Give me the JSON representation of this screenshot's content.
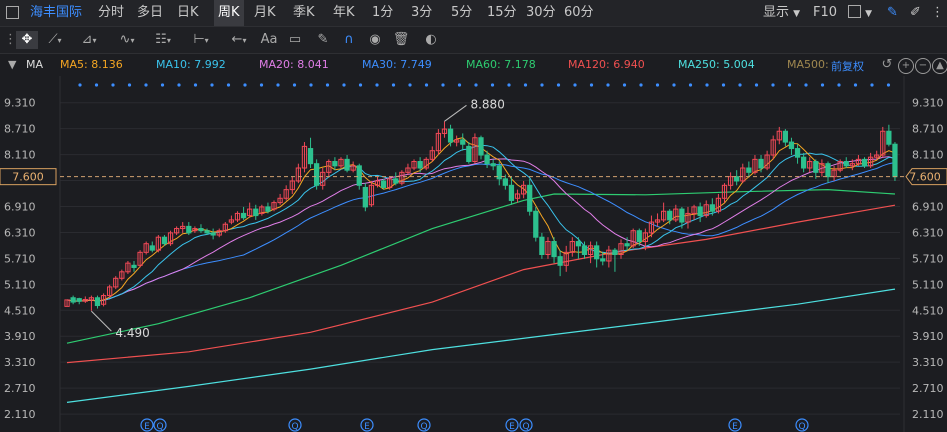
{
  "toolbar": {
    "stock_name": "海丰国际",
    "periods": [
      "分时",
      "多日",
      "日K",
      "周K",
      "月K",
      "季K",
      "年K",
      "1分",
      "3分",
      "5分",
      "15分",
      "30分",
      "60分"
    ],
    "selected_period": "周K",
    "display_label": "显示",
    "f10_label": "F10",
    "dropdown_icon": "chevron-down-icon"
  },
  "tools": {
    "text_tool_label": "Aa"
  },
  "indicators": {
    "label": "MA",
    "items": [
      {
        "label": "MA5: 8.136",
        "color": "#f5a623"
      },
      {
        "label": "MA10: 7.992",
        "color": "#3ac3ec"
      },
      {
        "label": "MA20: 8.041",
        "color": "#e07ee8"
      },
      {
        "label": "MA30: 7.749",
        "color": "#3d8eff"
      },
      {
        "label": "MA60: 7.178",
        "color": "#2ecc71"
      },
      {
        "label": "MA120: 6.940",
        "color": "#f05050"
      },
      {
        "label": "MA250: 5.004",
        "color": "#4ee0e0"
      },
      {
        "label": "MA500:",
        "color": "#a08850"
      }
    ],
    "adjust_label": "前复权"
  },
  "chart_data": {
    "type": "candlestick",
    "interval": "weekly",
    "y_ticks": [
      9.31,
      8.71,
      8.11,
      7.51,
      6.91,
      6.31,
      5.71,
      5.11,
      4.51,
      3.91,
      3.31,
      2.71,
      2.11
    ],
    "y_tick_labels": [
      "9.310",
      "8.710",
      "8.110",
      "7.510",
      "6.910",
      "6.310",
      "5.710",
      "5.110",
      "4.510",
      "3.910",
      "3.310",
      "2.710",
      "2.110"
    ],
    "ylim": [
      1.95,
      9.65
    ],
    "current_price": 7.6,
    "current_price_label": "7.600",
    "annotations": [
      {
        "text": "8.880",
        "value": 8.88,
        "type": "high"
      },
      {
        "text": "4.490",
        "value": 4.49,
        "type": "low"
      }
    ],
    "candles": [
      [
        4.6,
        4.75,
        4.75,
        4.6
      ],
      [
        4.8,
        4.7,
        4.85,
        4.65
      ],
      [
        4.78,
        4.72,
        4.8,
        4.65
      ],
      [
        4.72,
        4.76,
        4.83,
        4.68
      ],
      [
        4.75,
        4.8,
        4.85,
        4.5
      ],
      [
        4.8,
        4.62,
        4.85,
        4.55
      ],
      [
        4.65,
        4.85,
        4.9,
        4.6
      ],
      [
        4.85,
        5.05,
        5.1,
        4.8
      ],
      [
        5.05,
        5.25,
        5.3,
        5.0
      ],
      [
        5.25,
        5.4,
        5.45,
        5.2
      ],
      [
        5.4,
        5.6,
        5.65,
        5.35
      ],
      [
        5.55,
        5.5,
        5.65,
        5.4
      ],
      [
        5.55,
        5.85,
        5.9,
        5.5
      ],
      [
        5.85,
        6.05,
        6.1,
        5.8
      ],
      [
        6.0,
        5.9,
        6.1,
        5.85
      ],
      [
        5.9,
        6.2,
        6.25,
        5.85
      ],
      [
        6.2,
        6.05,
        6.25,
        6.0
      ],
      [
        6.05,
        6.3,
        6.35,
        6.0
      ],
      [
        6.3,
        6.4,
        6.45,
        6.25
      ],
      [
        6.4,
        6.45,
        6.55,
        6.3
      ],
      [
        6.45,
        6.3,
        6.55,
        6.25
      ],
      [
        6.35,
        6.4,
        6.45,
        6.3
      ],
      [
        6.4,
        6.35,
        6.5,
        6.3
      ],
      [
        6.35,
        6.3,
        6.4,
        6.25
      ],
      [
        6.3,
        6.25,
        6.4,
        6.15
      ],
      [
        6.25,
        6.35,
        6.4,
        6.2
      ],
      [
        6.35,
        6.5,
        6.55,
        6.3
      ],
      [
        6.55,
        6.6,
        6.7,
        6.5
      ],
      [
        6.6,
        6.75,
        6.8,
        6.55
      ],
      [
        6.75,
        6.65,
        6.9,
        6.6
      ],
      [
        6.7,
        6.85,
        7.0,
        6.65
      ],
      [
        6.85,
        6.7,
        6.95,
        6.6
      ],
      [
        6.75,
        6.9,
        6.95,
        6.7
      ],
      [
        6.9,
        6.8,
        7.0,
        6.75
      ],
      [
        6.85,
        7.0,
        7.05,
        6.8
      ],
      [
        7.0,
        7.1,
        7.2,
        6.95
      ],
      [
        7.1,
        7.3,
        7.4,
        7.05
      ],
      [
        7.3,
        7.5,
        7.6,
        7.2
      ],
      [
        7.5,
        7.8,
        7.9,
        7.45
      ],
      [
        7.8,
        8.3,
        8.4,
        7.7
      ],
      [
        8.25,
        7.9,
        8.5,
        7.8
      ],
      [
        7.9,
        7.4,
        8.0,
        7.3
      ],
      [
        7.4,
        7.7,
        7.8,
        7.3
      ],
      [
        7.7,
        7.95,
        8.0,
        7.6
      ],
      [
        7.95,
        7.85,
        8.05,
        7.75
      ],
      [
        7.85,
        8.0,
        8.05,
        7.8
      ],
      [
        8.0,
        7.75,
        8.1,
        7.7
      ],
      [
        7.75,
        7.85,
        7.95,
        7.7
      ],
      [
        7.85,
        7.4,
        7.9,
        7.3
      ],
      [
        7.35,
        6.9,
        7.45,
        6.8
      ],
      [
        6.95,
        7.4,
        7.5,
        6.9
      ],
      [
        7.4,
        7.5,
        7.6,
        7.35
      ],
      [
        7.5,
        7.35,
        7.55,
        7.3
      ],
      [
        7.35,
        7.55,
        7.6,
        7.3
      ],
      [
        7.55,
        7.45,
        7.7,
        7.4
      ],
      [
        7.45,
        7.7,
        7.75,
        7.4
      ],
      [
        7.7,
        7.8,
        7.9,
        7.65
      ],
      [
        7.8,
        7.95,
        8.0,
        7.75
      ],
      [
        7.95,
        7.8,
        8.05,
        7.7
      ],
      [
        7.8,
        8.0,
        8.05,
        7.75
      ],
      [
        8.0,
        8.2,
        8.3,
        7.95
      ],
      [
        8.2,
        8.6,
        8.7,
        8.1
      ],
      [
        8.6,
        8.7,
        8.88,
        8.5
      ],
      [
        8.7,
        8.4,
        8.8,
        8.3
      ],
      [
        8.4,
        8.45,
        8.55,
        8.3
      ],
      [
        8.45,
        8.35,
        8.6,
        8.2
      ],
      [
        8.3,
        7.95,
        8.4,
        7.9
      ],
      [
        7.95,
        8.5,
        8.6,
        7.9
      ],
      [
        8.5,
        8.1,
        8.55,
        8.0
      ],
      [
        8.1,
        7.9,
        8.2,
        7.8
      ],
      [
        7.9,
        7.85,
        8.0,
        7.75
      ],
      [
        7.85,
        7.55,
        7.95,
        7.4
      ],
      [
        7.55,
        7.4,
        7.65,
        7.3
      ],
      [
        7.4,
        7.05,
        7.6,
        6.95
      ],
      [
        7.1,
        7.2,
        7.3,
        7.0
      ],
      [
        7.2,
        7.4,
        7.5,
        7.1
      ],
      [
        7.4,
        6.8,
        7.55,
        6.7
      ],
      [
        6.8,
        6.2,
        6.9,
        6.1
      ],
      [
        6.2,
        5.8,
        6.3,
        5.7
      ],
      [
        5.8,
        6.1,
        6.2,
        5.7
      ],
      [
        6.1,
        5.75,
        6.2,
        5.6
      ],
      [
        5.75,
        5.55,
        5.9,
        5.3
      ],
      [
        5.55,
        5.85,
        6.0,
        5.4
      ],
      [
        5.85,
        6.1,
        6.2,
        5.75
      ],
      [
        6.1,
        6.0,
        6.2,
        5.7
      ],
      [
        6.0,
        5.8,
        6.1,
        5.7
      ],
      [
        5.8,
        6.0,
        6.1,
        5.6
      ],
      [
        6.0,
        5.7,
        6.1,
        5.5
      ],
      [
        5.7,
        5.65,
        5.85,
        5.55
      ],
      [
        5.65,
        5.9,
        6.0,
        5.5
      ],
      [
        5.9,
        5.8,
        5.95,
        5.4
      ],
      [
        5.8,
        6.05,
        6.15,
        5.7
      ],
      [
        6.05,
        6.0,
        6.2,
        5.9
      ],
      [
        6.0,
        6.35,
        6.4,
        5.95
      ],
      [
        6.35,
        6.1,
        6.4,
        6.0
      ],
      [
        6.1,
        6.3,
        6.4,
        5.9
      ],
      [
        6.3,
        6.55,
        6.7,
        6.2
      ],
      [
        6.55,
        6.6,
        6.75,
        6.45
      ],
      [
        6.6,
        6.8,
        7.0,
        6.55
      ],
      [
        6.8,
        6.6,
        6.85,
        6.5
      ],
      [
        6.6,
        6.85,
        6.95,
        6.55
      ],
      [
        6.85,
        6.55,
        6.9,
        6.4
      ],
      [
        6.55,
        6.75,
        6.9,
        6.4
      ],
      [
        6.75,
        6.9,
        6.95,
        6.6
      ],
      [
        6.9,
        6.7,
        7.0,
        6.55
      ],
      [
        6.7,
        6.95,
        7.05,
        6.65
      ],
      [
        6.95,
        6.8,
        7.1,
        6.7
      ],
      [
        6.8,
        7.1,
        7.2,
        6.75
      ],
      [
        7.1,
        7.4,
        7.45,
        7.0
      ],
      [
        7.4,
        7.6,
        7.7,
        7.3
      ],
      [
        7.6,
        7.5,
        7.75,
        7.4
      ],
      [
        7.5,
        7.8,
        7.9,
        7.45
      ],
      [
        7.8,
        7.7,
        7.95,
        7.6
      ],
      [
        7.7,
        8.0,
        8.1,
        7.65
      ],
      [
        8.0,
        7.8,
        8.1,
        7.7
      ],
      [
        7.8,
        8.1,
        8.2,
        7.75
      ],
      [
        8.1,
        8.45,
        8.55,
        8.0
      ],
      [
        8.45,
        8.65,
        8.75,
        8.35
      ],
      [
        8.65,
        8.4,
        8.7,
        8.3
      ],
      [
        8.4,
        8.25,
        8.5,
        8.1
      ],
      [
        8.25,
        8.05,
        8.35,
        7.9
      ],
      [
        8.05,
        7.8,
        8.15,
        7.7
      ],
      [
        7.8,
        7.95,
        8.05,
        7.7
      ],
      [
        7.95,
        7.7,
        8.0,
        7.55
      ],
      [
        7.7,
        7.9,
        8.0,
        7.6
      ],
      [
        7.9,
        7.6,
        7.95,
        7.45
      ],
      [
        7.6,
        7.75,
        7.85,
        7.5
      ],
      [
        7.75,
        7.95,
        8.0,
        7.7
      ],
      [
        7.95,
        7.85,
        8.05,
        7.8
      ],
      [
        7.85,
        7.9,
        8.0,
        7.75
      ],
      [
        7.9,
        8.0,
        8.1,
        7.85
      ],
      [
        8.0,
        7.85,
        8.05,
        7.8
      ],
      [
        7.85,
        8.05,
        8.15,
        7.8
      ],
      [
        8.05,
        8.1,
        8.2,
        8.0
      ],
      [
        8.1,
        8.65,
        8.75,
        8.05
      ],
      [
        8.65,
        8.35,
        8.8,
        8.3
      ],
      [
        8.35,
        7.6,
        8.4,
        7.5
      ]
    ],
    "ma_colors": {
      "MA5": "#f5a623",
      "MA10": "#3ac3ec",
      "MA20": "#e07ee8",
      "MA30": "#3d8eff",
      "MA60": "#2ecc71",
      "MA120": "#f05050",
      "MA250": "#4ee0e0"
    },
    "ma60_points": [
      [
        0,
        3.75
      ],
      [
        15,
        4.2
      ],
      [
        30,
        4.8
      ],
      [
        45,
        5.55
      ],
      [
        60,
        6.4
      ],
      [
        75,
        7.05
      ],
      [
        80,
        7.2
      ],
      [
        95,
        7.18
      ],
      [
        110,
        7.25
      ],
      [
        125,
        7.3
      ],
      [
        140,
        7.2
      ]
    ],
    "ma120_points": [
      [
        0,
        3.3
      ],
      [
        20,
        3.55
      ],
      [
        40,
        4.0
      ],
      [
        60,
        4.7
      ],
      [
        75,
        5.45
      ],
      [
        90,
        5.85
      ],
      [
        105,
        6.15
      ],
      [
        120,
        6.55
      ],
      [
        140,
        6.94
      ]
    ],
    "ma250_points": [
      [
        0,
        2.38
      ],
      [
        20,
        2.75
      ],
      [
        40,
        3.15
      ],
      [
        60,
        3.6
      ],
      [
        80,
        3.95
      ],
      [
        100,
        4.3
      ],
      [
        120,
        4.65
      ],
      [
        140,
        5.0
      ]
    ],
    "markers_top": "dots",
    "markers_bottom": [
      "E",
      "Q",
      "Q",
      "E",
      "Q",
      "E",
      "Q",
      "E",
      "Q"
    ]
  },
  "toolbar_right": {
    "undo_icon": "undo-icon",
    "zoom_in_icon": "plus-circle-icon",
    "zoom_out_icon": "minus-circle-icon",
    "collapse_icon": "chevron-up-icon"
  }
}
